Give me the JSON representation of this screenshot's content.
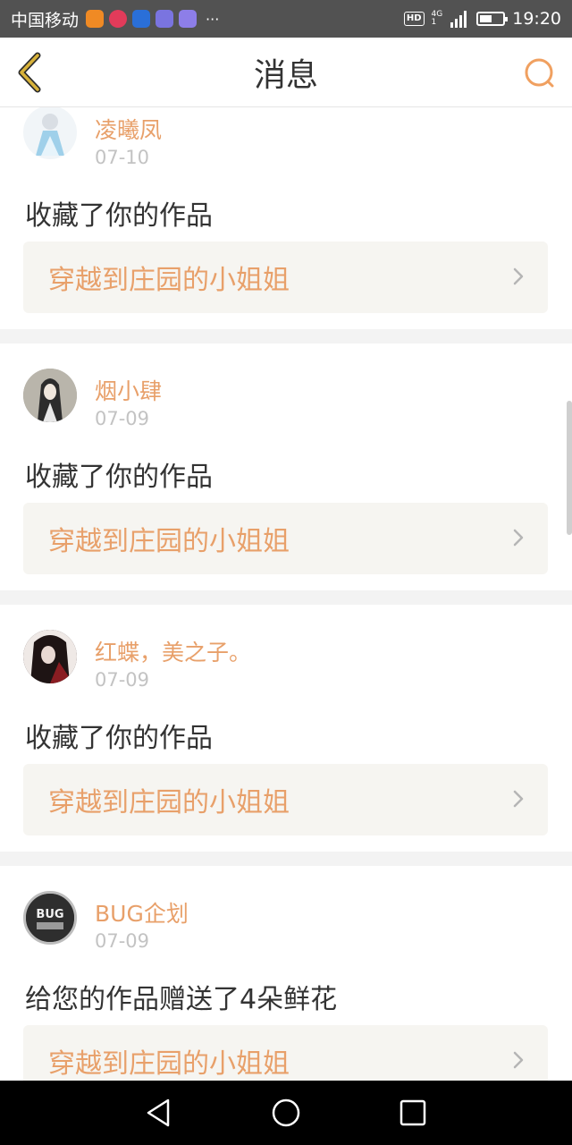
{
  "status_bar": {
    "carrier": "中国移动",
    "dots": "···",
    "hd": "HD",
    "network": "4G",
    "network_sub": "1",
    "time": "19:20",
    "battery_level": 0.55
  },
  "header": {
    "title": "消息"
  },
  "messages": [
    {
      "name": "凌曦凤",
      "date": "07-10",
      "action": "收藏了你的作品",
      "work_title": "穿越到庄园的小姐姐"
    },
    {
      "name": "烟小肆",
      "date": "07-09",
      "action": "收藏了你的作品",
      "work_title": "穿越到庄园的小姐姐"
    },
    {
      "name": "红蝶，美之子。",
      "date": "07-09",
      "action": "收藏了你的作品",
      "work_title": "穿越到庄园的小姐姐"
    },
    {
      "name": "BUG企划",
      "date": "07-09",
      "action": "给您的作品赠送了4朵鲜花",
      "work_title": "穿越到庄园的小姐姐",
      "avatar_text": "BUG"
    }
  ],
  "colors": {
    "accent": "#e8a06a",
    "back_arrow": "#c8a23a",
    "status_bar": "#525252"
  }
}
